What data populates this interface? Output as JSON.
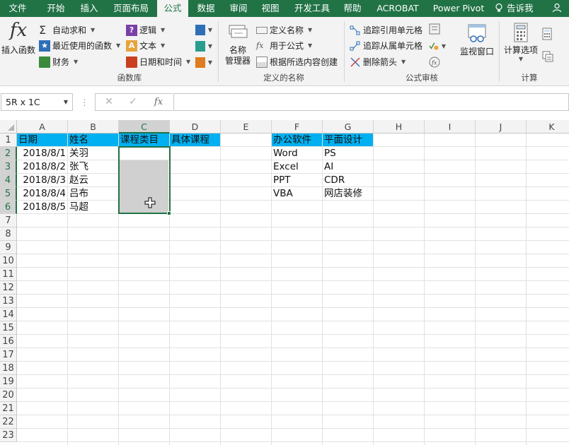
{
  "tabs": [
    "文件",
    "开始",
    "插入",
    "页面布局",
    "公式",
    "数据",
    "审阅",
    "视图",
    "开发工具",
    "帮助",
    "ACROBAT",
    "Power Pivot"
  ],
  "active_tab": "公式",
  "tell_me": "告诉我",
  "ribbon": {
    "insert_function": "插入函数",
    "function_library": {
      "autosum": "自动求和",
      "recent": "最近使用的函数",
      "financial": "财务",
      "logical": "逻辑",
      "text": "文本",
      "datetime": "日期和时间",
      "group_label": "函数库"
    },
    "defined_names": {
      "name_manager_line1": "名称",
      "name_manager_line2": "管理器",
      "define_name": "定义名称",
      "use_in_formula": "用于公式",
      "create_from_selection": "根据所选内容创建",
      "group_label": "定义的名称"
    },
    "formula_auditing": {
      "trace_precedents": "追踪引用单元格",
      "trace_dependents": "追踪从属单元格",
      "remove_arrows": "删除箭头",
      "watch_window": "监视窗口",
      "group_label": "公式审核"
    },
    "calculation": {
      "calc_options": "计算选项",
      "group_label": "计算"
    }
  },
  "formula_bar": {
    "name_box": "5R x 1C",
    "cancel_glyph": "✕",
    "enter_glyph": "✓",
    "fx_glyph": "fx",
    "formula": ""
  },
  "columns": [
    "A",
    "B",
    "C",
    "D",
    "E",
    "F",
    "G",
    "H",
    "I",
    "J",
    "K"
  ],
  "rows": [
    "1",
    "2",
    "3",
    "4",
    "5",
    "6",
    "7",
    "8",
    "9",
    "10",
    "11",
    "12",
    "13",
    "14",
    "15",
    "16",
    "17",
    "18",
    "19",
    "20",
    "21",
    "22",
    "23"
  ],
  "sheet": {
    "headers": {
      "A1": "日期",
      "B1": "姓名",
      "C1": "课程类目",
      "D1": "具体课程",
      "F1": "办公软件",
      "G1": "平面设计"
    },
    "dates": [
      "2018/8/1",
      "2018/8/2",
      "2018/8/3",
      "2018/8/4",
      "2018/8/5"
    ],
    "names": [
      "关羽",
      "张飞",
      "赵云",
      "吕布",
      "马超"
    ],
    "office_software": [
      "Word",
      "Excel",
      "PPT",
      "VBA"
    ],
    "graphic_design": [
      "PS",
      "AI",
      "CDR",
      "网店装修"
    ]
  },
  "colors": {
    "ribbon_green": "#217346",
    "header_fill": "#00b0f0",
    "selection_shade": "#d0d0d0"
  }
}
